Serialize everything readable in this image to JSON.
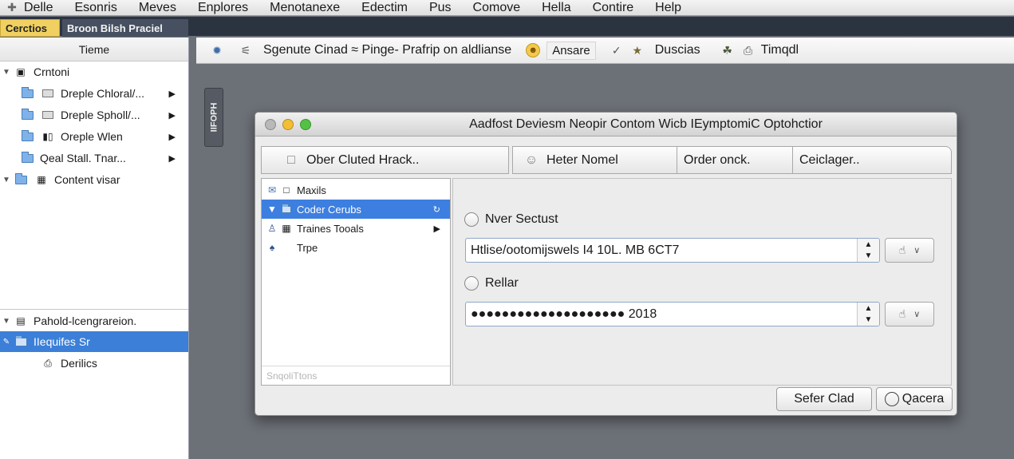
{
  "menubar": {
    "items": [
      "Delle",
      "Esonris",
      "Meves",
      "Enplores",
      "Menotanexe",
      "Edectim",
      "Pus",
      "Comove",
      "Hella",
      "Contire",
      "Help"
    ]
  },
  "left_tabs": {
    "active": "Cerctios",
    "inactive": "Broon Bilsh Praciel"
  },
  "sidebar": {
    "header": "Tieme",
    "top_items": [
      {
        "label": "Crntoni",
        "expanded": true
      },
      {
        "label": "Dreple Chloral/..."
      },
      {
        "label": "Dreple Spholl/..."
      },
      {
        "label": "Oreple Wlen"
      },
      {
        "label": "Qeal Stall. Tnar..."
      },
      {
        "label": "Content visar",
        "expanded": true
      }
    ],
    "bottom_items": [
      {
        "label": "Pahold-lcengrareion."
      },
      {
        "label": "IIequifes Sr",
        "selected": true
      },
      {
        "label": "Derilics"
      }
    ]
  },
  "toolbar": {
    "title": "Sgenute Cinad ≈ Pinge- Prafrip on aldlianse",
    "answer_label": "Ansare",
    "discuss_label": "Duscias",
    "tingal_label": "Timqdl"
  },
  "side_tab": {
    "label": "IIFOPH"
  },
  "dialog": {
    "title": "Aadfost Deviesm Neopir Contom Wicb IEymptomiC Optohctior",
    "tabs": [
      "Ober Cluted Hrack..",
      "Heter Nomel",
      "Order onck.",
      "Ceiclager.."
    ],
    "list": {
      "items": [
        {
          "label": "Maxils"
        },
        {
          "label": "Coder Cerubs",
          "selected": true
        },
        {
          "label": "Traines Tooals"
        },
        {
          "label": "Trpe"
        }
      ],
      "footer": "SnqoliTtons"
    },
    "option1": {
      "label": "Nver Sectust",
      "value": "Htlise/ootomijswels I4 10L. MB 6CT7"
    },
    "option2": {
      "label": "Rellar",
      "value": "●●●●●●●●●●●●●●●●●●●● 2018"
    },
    "ok_label": "Sefer Clad",
    "cancel_label": "Qacera"
  }
}
